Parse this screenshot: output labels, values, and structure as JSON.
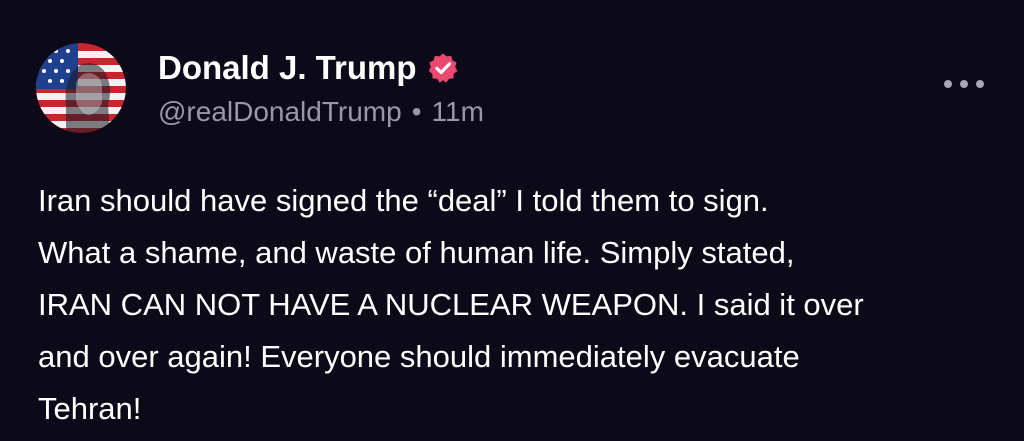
{
  "post": {
    "author": {
      "display_name": "Donald J. Trump",
      "handle": "@realDonaldTrump",
      "verified": true,
      "avatar_icon": "flag-portrait-avatar"
    },
    "separator": "•",
    "timestamp": "11m",
    "more_icon": "more-horizontal-icon",
    "body_lines": [
      "Iran should have signed the “deal” I told them to sign.",
      "What a shame, and waste of human life. Simply stated,",
      "IRAN CAN NOT HAVE A NUCLEAR WEAPON. I said it over",
      "and over again! Everyone should immediately evacuate",
      "Tehran!"
    ]
  },
  "colors": {
    "background": "#0c0a19",
    "text_primary": "#ffffff",
    "text_secondary": "#9a98a8",
    "verified_badge": "#e84a6f"
  }
}
